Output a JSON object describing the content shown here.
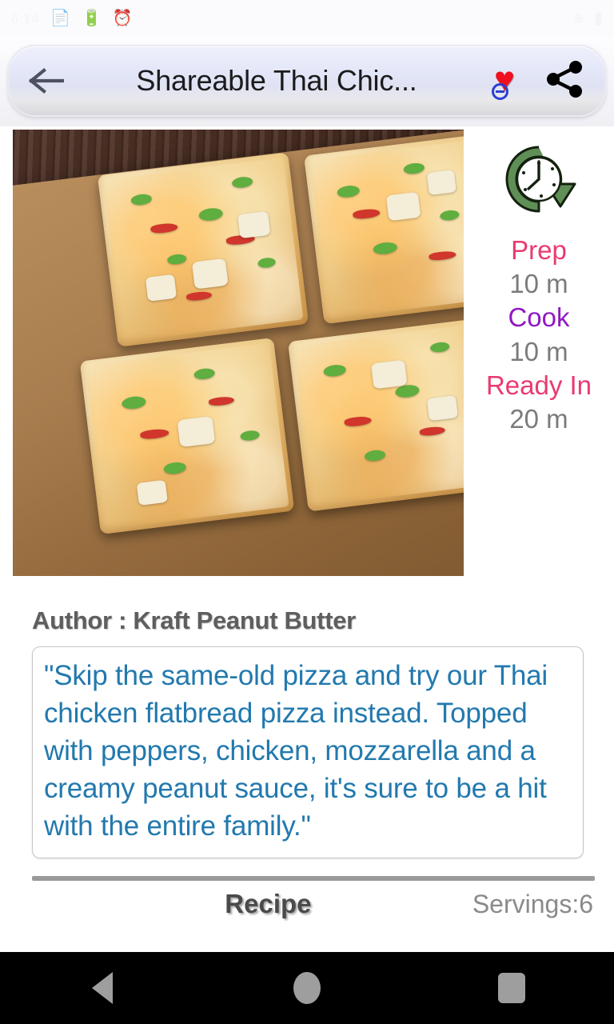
{
  "status_bar": {
    "time": "6:14",
    "left_icons": [
      "clock-icon",
      "file-icon",
      "battery-saver-icon",
      "alarm-icon"
    ],
    "right_icons": [
      "usb-icon",
      "battery-icon"
    ]
  },
  "toolbar": {
    "back_label": "←",
    "back_icon": "back-arrow-icon",
    "title": "Shareable Thai Chic...",
    "favorite_icon": "heart-remove-favorite-icon",
    "favorite_heart_glyph": "♥",
    "favorite_color": "#ef1020",
    "favorite_badge_color": "#2b3fd0",
    "share_icon": "share-icon"
  },
  "recipe": {
    "photo_alt": "thai-chicken-flatbread-pizza-photo",
    "timing": {
      "clock_icon": "green-clock-arrow-icon",
      "clock_color": "#558b4e",
      "prep_label": "Prep",
      "prep_value": "10 m",
      "cook_label": "Cook",
      "cook_value": "10 m",
      "ready_label": "Ready In",
      "ready_value": "20 m",
      "prep_color": "#ea3a70",
      "cook_color": "#9018c2",
      "ready_color": "#ea3a70",
      "value_color": "#7b7b7b"
    },
    "author_line": "Author : Kraft Peanut Butter",
    "description": "\"Skip the same-old pizza and try our Thai chicken flatbread pizza instead. Topped with peppers, chicken, mozzarella and a creamy peanut sauce, it's sure to be a hit with the entire family.\"",
    "description_color": "#2279ae",
    "recipe_tab_label": "Recipe",
    "servings_label": "Servings:6"
  },
  "nav_bar": {
    "back_icon": "nav-back-triangle-icon",
    "home_icon": "nav-home-circle-icon",
    "recents_icon": "nav-recents-square-icon"
  }
}
